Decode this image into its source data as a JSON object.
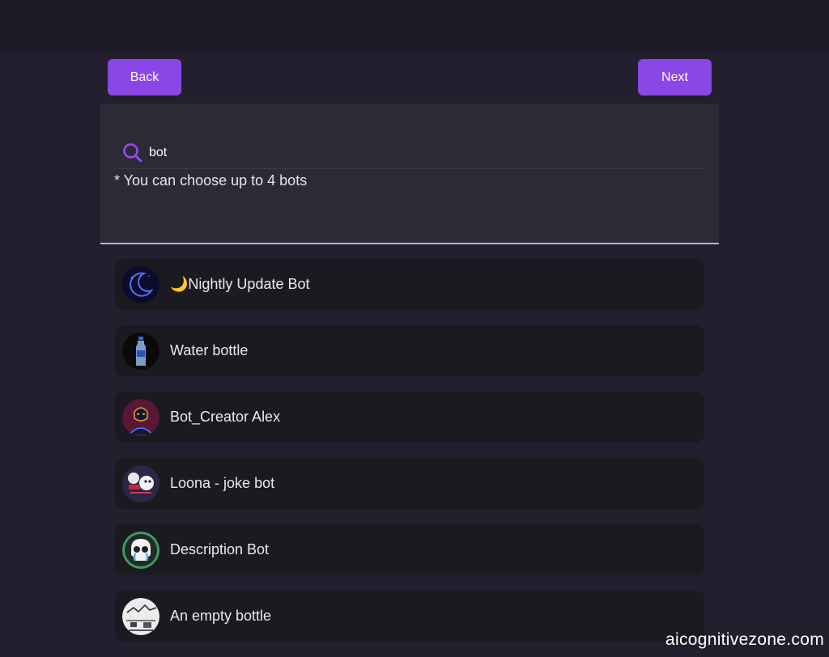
{
  "nav": {
    "back_label": "Back",
    "next_label": "Next"
  },
  "search": {
    "value": "bot",
    "hint": "* You can choose up to 4 bots"
  },
  "bots": [
    {
      "name": "🌙Nightly Update Bot",
      "avatar_icon": "moon-avatar-icon"
    },
    {
      "name": "Water bottle",
      "avatar_icon": "water-bottle-avatar-icon"
    },
    {
      "name": "Bot_Creator Alex",
      "avatar_icon": "neon-figure-avatar-icon"
    },
    {
      "name": "Loona - joke bot",
      "avatar_icon": "cartoon-avatar-icon"
    },
    {
      "name": "Description Bot",
      "avatar_icon": "crying-skull-avatar-icon"
    },
    {
      "name": "An empty bottle",
      "avatar_icon": "sketch-avatar-icon"
    }
  ],
  "watermark": "aicognitivezone.com",
  "colors": {
    "accent": "#8b46e8",
    "background": "#231f2e",
    "card": "#1b1a21",
    "panel": "#2d2a38"
  }
}
